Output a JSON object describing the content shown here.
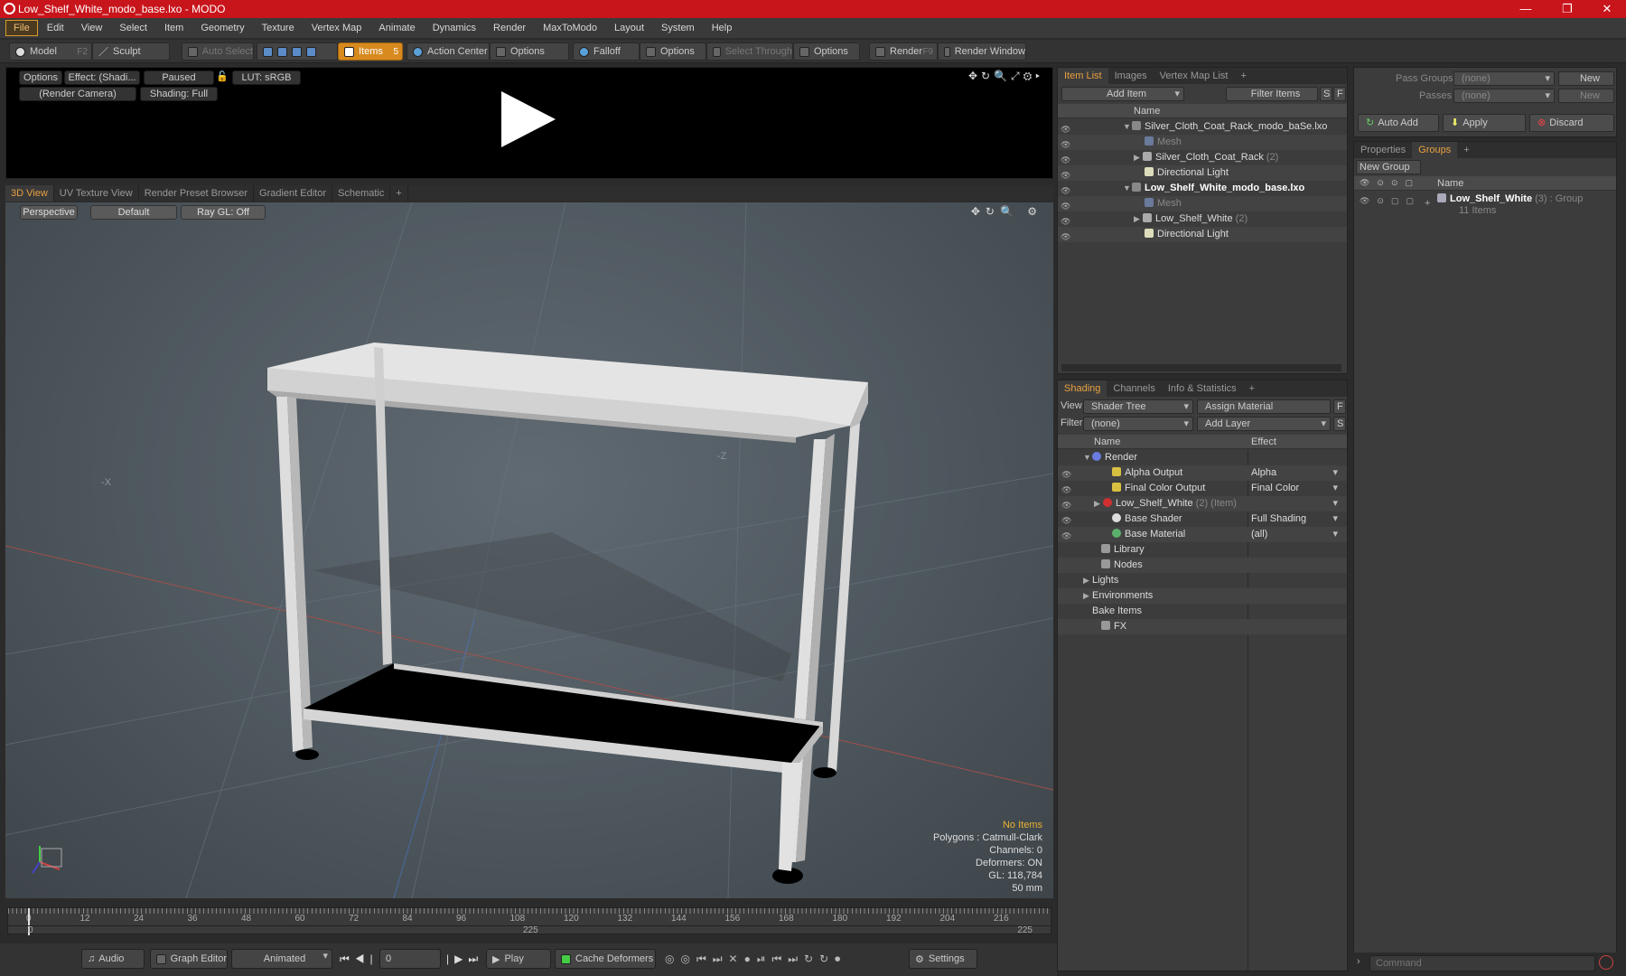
{
  "window": {
    "title": "Low_Shelf_White_modo_base.lxo - MODO",
    "minimize": "—",
    "maximize": "❐",
    "close": "✕"
  },
  "menu": [
    "File",
    "Edit",
    "View",
    "Select",
    "Item",
    "Geometry",
    "Texture",
    "Vertex Map",
    "Animate",
    "Dynamics",
    "Render",
    "MaxToModo",
    "Layout",
    "System",
    "Help"
  ],
  "toolbar": {
    "model": "Model",
    "model_key": "F2",
    "sculpt": "Sculpt",
    "auto_select": "Auto Select",
    "items": "Items",
    "items_key": "5",
    "action_center": "Action Center",
    "options1": "Options",
    "falloff": "Falloff",
    "options2": "Options",
    "select_through": "Select Through",
    "options3": "Options",
    "render": "Render",
    "render_key": "F9",
    "render_window": "Render Window"
  },
  "preview": {
    "options": "Options",
    "effect": "Effect: (Shadi...",
    "paused": "Paused",
    "lut": "LUT: sRGB",
    "camera": "(Render Camera)",
    "shading": "Shading: Full"
  },
  "viewport_tabs": [
    "3D View",
    "UV Texture View",
    "Render Preset Browser",
    "Gradient Editor",
    "Schematic",
    "+"
  ],
  "viewport": {
    "perspective": "Perspective",
    "default": "Default",
    "raygl": "Ray GL: Off",
    "axis_neg_x": "-X",
    "axis_neg_z": "-Z",
    "info": {
      "no_items": "No Items",
      "polygons": "Polygons : Catmull-Clark",
      "channels": "Channels: 0",
      "deformers": "Deformers: ON",
      "gl": "GL: 118,784",
      "scale": "50 mm"
    }
  },
  "timeline": {
    "ticks": [
      "0",
      "12",
      "24",
      "36",
      "48",
      "60",
      "72",
      "84",
      "96",
      "108",
      "120",
      "132",
      "144",
      "156",
      "168",
      "180",
      "192",
      "204",
      "216"
    ],
    "start": "0",
    "mid": "225",
    "end": "225"
  },
  "bottombar": {
    "audio": "Audio",
    "graph_editor": "Graph Editor",
    "animated": "Animated",
    "frame": "0",
    "play": "Play",
    "cache_deformers": "Cache Deformers",
    "settings": "Settings"
  },
  "item_list": {
    "tabs": [
      "Item List",
      "Images",
      "Vertex Map List",
      "+"
    ],
    "add_item": "Add Item",
    "filter_items": "Filter Items",
    "s": "S",
    "f": "F",
    "col_name": "Name",
    "rows": [
      {
        "label": "Silver_Cloth_Coat_Rack_modo_baSe.lxo",
        "count": ""
      },
      {
        "label": "Mesh",
        "count": ""
      },
      {
        "label": "Silver_Cloth_Coat_Rack",
        "count": "(2)"
      },
      {
        "label": "Directional Light",
        "count": ""
      },
      {
        "label": "Low_Shelf_White_modo_base.lxo",
        "count": ""
      },
      {
        "label": "Mesh",
        "count": ""
      },
      {
        "label": "Low_Shelf_White",
        "count": "(2)"
      },
      {
        "label": "Directional Light",
        "count": ""
      }
    ]
  },
  "shading": {
    "tabs": [
      "Shading",
      "Channels",
      "Info & Statistics",
      "+"
    ],
    "view_label": "View",
    "view_value": "Shader Tree",
    "assign_material": "Assign Material",
    "filter_label": "Filter",
    "filter_value": "(none)",
    "add_layer": "Add Layer",
    "f": "F",
    "s": "S",
    "col_name": "Name",
    "col_effect": "Effect",
    "rows": [
      {
        "label": "Render",
        "effect": ""
      },
      {
        "label": "Alpha Output",
        "effect": "Alpha"
      },
      {
        "label": "Final Color Output",
        "effect": "Final Color"
      },
      {
        "label": "Low_Shelf_White",
        "extra": "(2) (Item)",
        "effect": ""
      },
      {
        "label": "Base Shader",
        "effect": "Full Shading"
      },
      {
        "label": "Base Material",
        "effect": "(all)"
      },
      {
        "label": "Library",
        "effect": ""
      },
      {
        "label": "Nodes",
        "effect": ""
      },
      {
        "label": "Lights",
        "effect": ""
      },
      {
        "label": "Environments",
        "effect": ""
      },
      {
        "label": "Bake Items",
        "effect": ""
      },
      {
        "label": "FX",
        "effect": ""
      }
    ]
  },
  "passes": {
    "pass_groups_label": "Pass Groups",
    "pass_groups_value": "(none)",
    "new1": "New",
    "passes_label": "Passes",
    "passes_value": "(none)",
    "new2": "New",
    "auto_add": "Auto Add",
    "apply": "Apply",
    "discard": "Discard"
  },
  "groups": {
    "tabs": [
      "Properties",
      "Groups",
      "+"
    ],
    "new_group": "New Group",
    "col_name": "Name",
    "group_name": "Low_Shelf_White",
    "group_meta": "(3) : Group",
    "group_items": "11 Items"
  },
  "command": {
    "placeholder": "Command"
  },
  "colors": {
    "accent": "#e8a040",
    "title_bar": "#c8141b"
  }
}
